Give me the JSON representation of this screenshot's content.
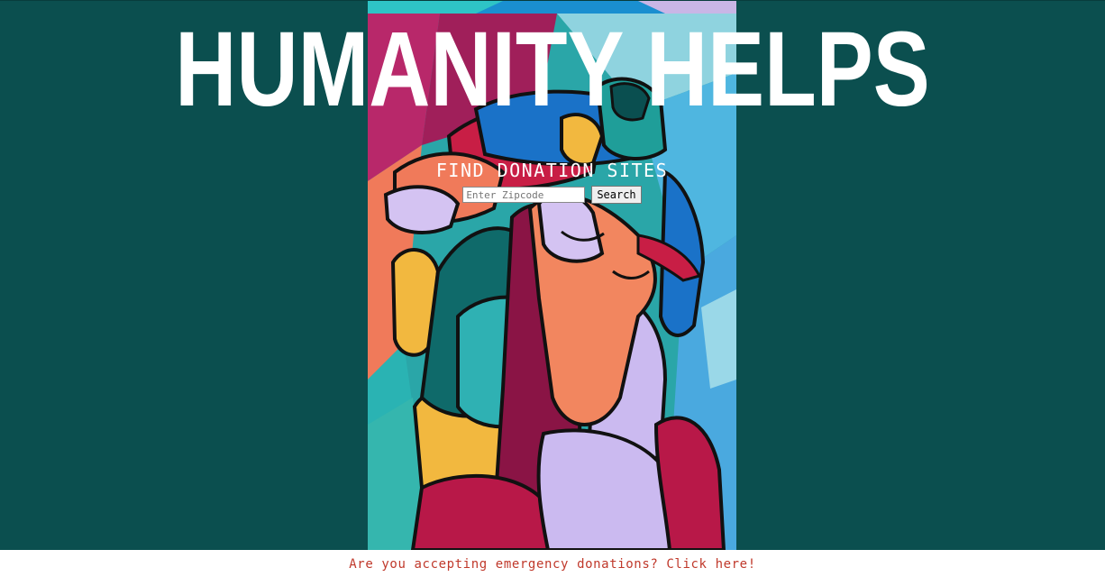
{
  "page": {
    "background_color": "#0b4f4f"
  },
  "header": {
    "title": "HUMANITY HELPS"
  },
  "hero": {
    "image": "colorful-hands-mural",
    "image_description_icon": "hands-mural-image"
  },
  "search": {
    "heading": "FIND DONATION SITES",
    "zip_placeholder": "Enter Zipcode",
    "zip_value": "",
    "button_label": "Search"
  },
  "footer": {
    "link_text": "Are you accepting emergency donations? Click here!",
    "link_color": "#c0392b",
    "background_color": "#ffffff"
  }
}
